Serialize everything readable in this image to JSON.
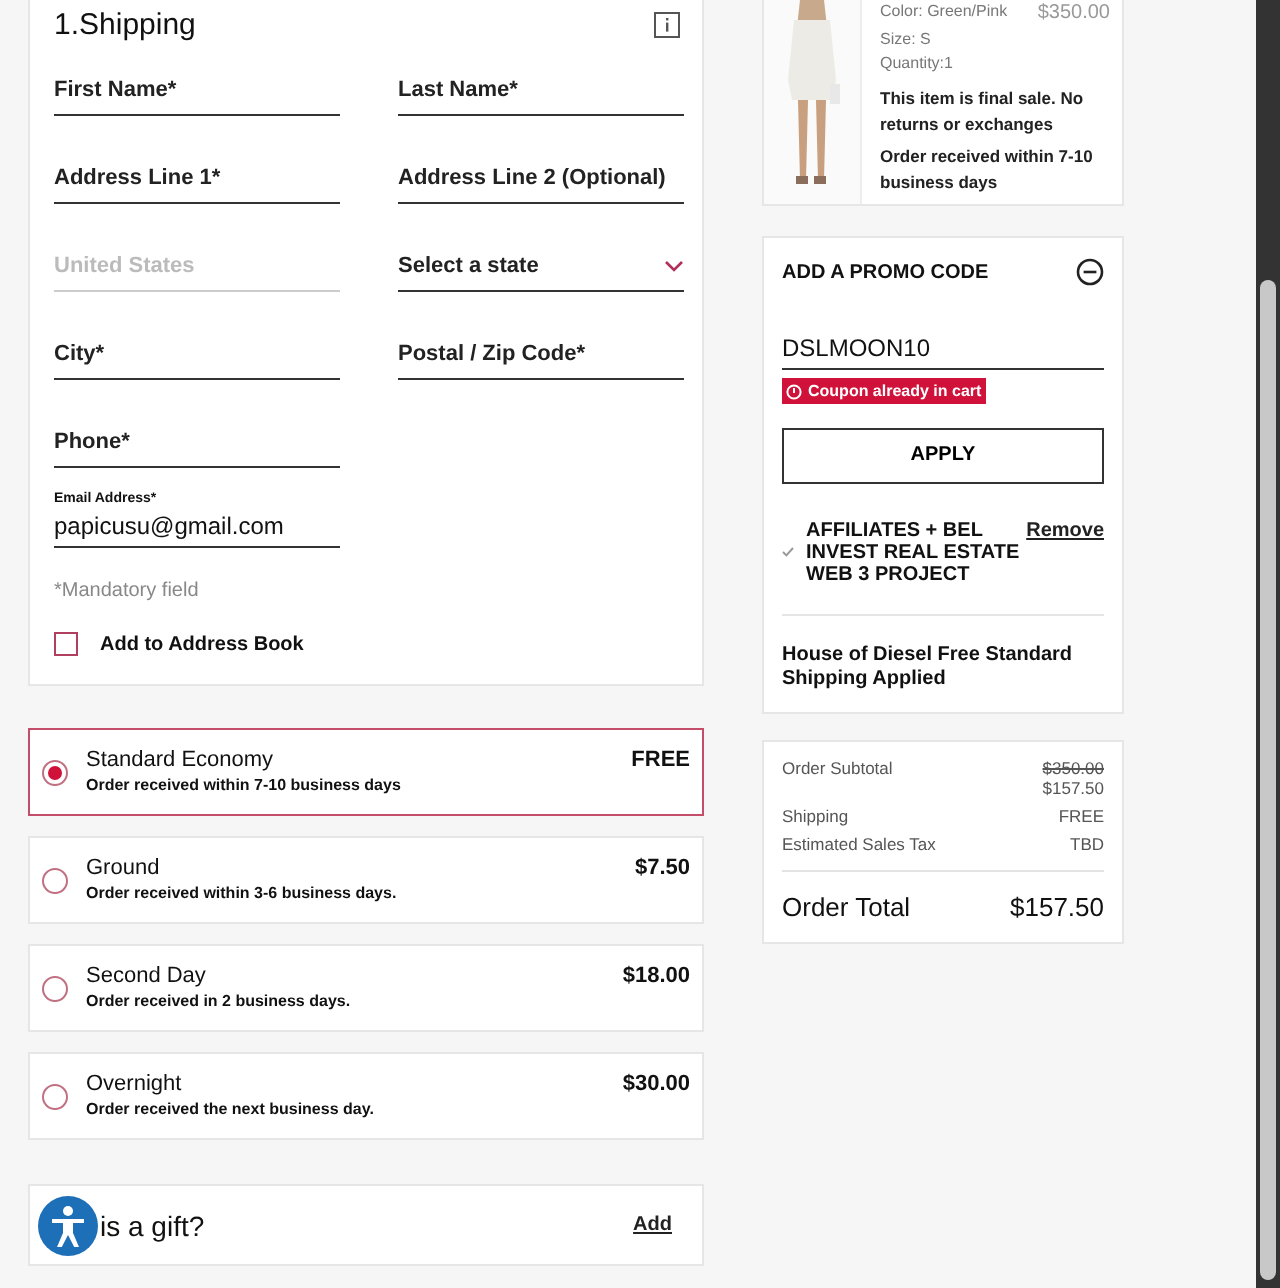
{
  "shipping": {
    "title": "1.Shipping",
    "fields": [
      {
        "label": "First Name*",
        "kind": "text"
      },
      {
        "label": "Last Name*",
        "kind": "text"
      },
      {
        "label": "Address Line 1*",
        "kind": "text"
      },
      {
        "label": "Address Line 2 (Optional)",
        "kind": "text"
      },
      {
        "label": "United States",
        "kind": "disabled"
      },
      {
        "label": "Select a state",
        "kind": "select"
      },
      {
        "label": "City*",
        "kind": "text"
      },
      {
        "label": "Postal / Zip Code*",
        "kind": "text"
      },
      {
        "label": "Phone*",
        "kind": "text"
      }
    ],
    "email": {
      "label": "Email Address*",
      "value": "papicusu@gmail.com"
    },
    "note": "*Mandatory field",
    "address_book": {
      "label": "Add to Address Book",
      "checked": false
    }
  },
  "options": [
    {
      "name": "Standard Economy",
      "detail": "Order received within 7-10 business days",
      "price": "FREE",
      "selected": true
    },
    {
      "name": "Ground",
      "detail": "Order received within 3-6 business days.",
      "price": "$7.50",
      "selected": false
    },
    {
      "name": "Second Day",
      "detail": "Order received in 2 business days.",
      "price": "$18.00",
      "selected": false
    },
    {
      "name": "Overnight",
      "detail": "Order received the next business day.",
      "price": "$30.00",
      "selected": false
    }
  ],
  "gift": {
    "label": "is a gift?",
    "action": "Add"
  },
  "item": {
    "variant": "Color: Green/Pink",
    "price": "$350.00",
    "size": "Size: S",
    "quantity": "Quantity:1",
    "note": "This item is final sale. No returns or exchanges",
    "delivery": "Order received within 7-10 business days"
  },
  "promo": {
    "title": "ADD A PROMO CODE",
    "code": "DSLMOON10",
    "error": "Coupon already in cart",
    "apply": "APPLY",
    "coupon": "AFFILIATES + BEL INVEST REAL ESTATE WEB 3 PROJECT",
    "remove": "Remove",
    "free_shipping": "House of Diesel Free Standard Shipping Applied"
  },
  "summary": {
    "rows": [
      {
        "label": "Order Subtotal",
        "values": [
          "$350.00",
          "$157.50"
        ]
      },
      {
        "label": "Shipping",
        "values": [
          "FREE"
        ]
      },
      {
        "label": "Estimated Sales Tax",
        "values": [
          "TBD"
        ]
      }
    ],
    "total_label": "Order Total",
    "total": "$157.50"
  }
}
